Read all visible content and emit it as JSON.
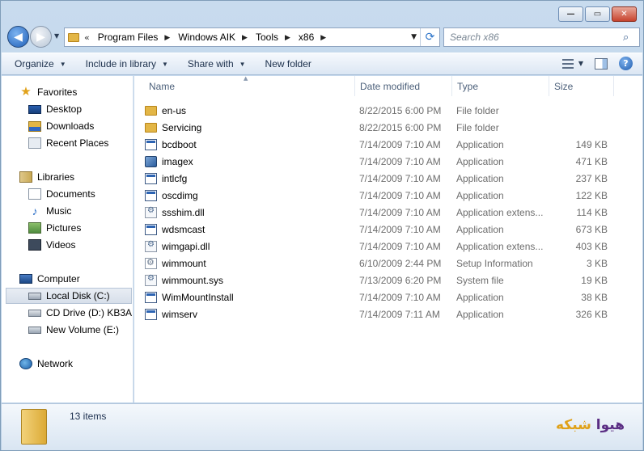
{
  "caption_buttons": {
    "minimize": "—",
    "maximize": "▭",
    "close": "✕"
  },
  "nav": {
    "back_glyph": "◀",
    "forward_glyph": "▶",
    "history_glyph": "▼"
  },
  "address": {
    "chevrons": "«",
    "crumbs": [
      "Program Files",
      "Windows AIK",
      "Tools",
      "x86"
    ],
    "crumb_sep": "▶",
    "dropdown_glyph": "▼",
    "refresh_glyph": "⟳"
  },
  "search": {
    "placeholder": "Search x86",
    "icon_glyph": "⌕"
  },
  "commandbar": {
    "organize": "Organize",
    "include_in_library": "Include in library",
    "share_with": "Share with",
    "new_folder": "New folder",
    "dropdown_glyph": "▼",
    "help_glyph": "?"
  },
  "sidebar": {
    "favorites_label": "Favorites",
    "desktop": "Desktop",
    "downloads": "Downloads",
    "recent_places": "Recent Places",
    "libraries_label": "Libraries",
    "documents": "Documents",
    "music": "Music",
    "pictures": "Pictures",
    "videos": "Videos",
    "computer_label": "Computer",
    "local_disk": "Local Disk (C:)",
    "cd_drive": "CD Drive (D:) KB3AIK",
    "new_volume": "New Volume (E:)",
    "network_label": "Network",
    "star_glyph": "★",
    "note_glyph": "♪"
  },
  "columns": {
    "name": "Name",
    "date": "Date modified",
    "type": "Type",
    "size": "Size",
    "sort_glyph": "▲"
  },
  "files": [
    {
      "name": "en-us",
      "date": "8/22/2015 6:00 PM",
      "type": "File folder",
      "size": "",
      "icon": "folder"
    },
    {
      "name": "Servicing",
      "date": "8/22/2015 6:00 PM",
      "type": "File folder",
      "size": "",
      "icon": "folder"
    },
    {
      "name": "bcdboot",
      "date": "7/14/2009 7:10 AM",
      "type": "Application",
      "size": "149 KB",
      "icon": "app"
    },
    {
      "name": "imagex",
      "date": "7/14/2009 7:10 AM",
      "type": "Application",
      "size": "471 KB",
      "icon": "imagex"
    },
    {
      "name": "intlcfg",
      "date": "7/14/2009 7:10 AM",
      "type": "Application",
      "size": "237 KB",
      "icon": "app"
    },
    {
      "name": "oscdimg",
      "date": "7/14/2009 7:10 AM",
      "type": "Application",
      "size": "122 KB",
      "icon": "app"
    },
    {
      "name": "ssshim.dll",
      "date": "7/14/2009 7:10 AM",
      "type": "Application extens...",
      "size": "114 KB",
      "icon": "dll"
    },
    {
      "name": "wdsmcast",
      "date": "7/14/2009 7:10 AM",
      "type": "Application",
      "size": "673 KB",
      "icon": "app"
    },
    {
      "name": "wimgapi.dll",
      "date": "7/14/2009 7:10 AM",
      "type": "Application extens...",
      "size": "403 KB",
      "icon": "dll"
    },
    {
      "name": "wimmount",
      "date": "6/10/2009 2:44 PM",
      "type": "Setup Information",
      "size": "3 KB",
      "icon": "inf"
    },
    {
      "name": "wimmount.sys",
      "date": "7/13/2009 6:20 PM",
      "type": "System file",
      "size": "19 KB",
      "icon": "dll"
    },
    {
      "name": "WimMountInstall",
      "date": "7/14/2009 7:10 AM",
      "type": "Application",
      "size": "38 KB",
      "icon": "app"
    },
    {
      "name": "wimserv",
      "date": "7/14/2009 7:11 AM",
      "type": "Application",
      "size": "326 KB",
      "icon": "app"
    }
  ],
  "details": {
    "item_count": "13 items"
  },
  "watermark": {
    "part_a": "هیوا",
    "part_b": "شبکه"
  }
}
